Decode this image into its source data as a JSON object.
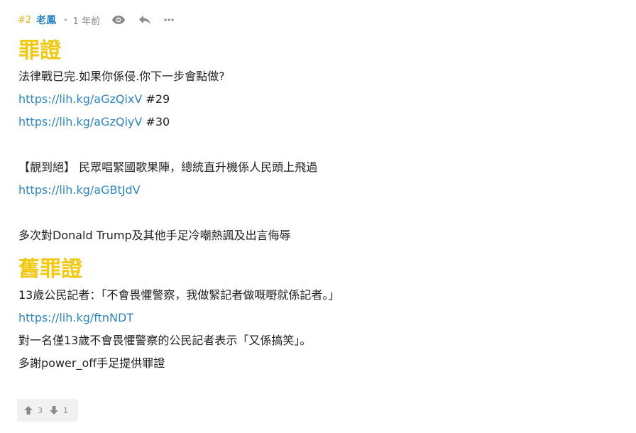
{
  "post": {
    "number": "#2",
    "author": "老鳳",
    "separator": "•",
    "time": "1 年前",
    "icons": [
      "eye-icon",
      "reply-icon",
      "more-icon"
    ]
  },
  "content": {
    "heading1": "罪證",
    "line1": "法律戰已完.如果你係侵.你下一步會點做?",
    "link1": "https://lih.kg/aGzQixV",
    "link1_suffix": " #29",
    "link2": "https://lih.kg/aGzQiyV",
    "link2_suffix": " #30",
    "line2": "【靚到絕】 民眾唱緊國歌果陣，總統直升機係人民頭上飛過",
    "link3": "https://lih.kg/aGBtJdV",
    "line3": "多次對Donald Trump及其他手足冷嘲熱諷及出言侮辱",
    "heading2": "舊罪證",
    "line4": "13歲公民記者：「不會畏懼警察，我做緊記者做嘅嘢就係記者。」",
    "link4": "https://lih.kg/ftnNDT",
    "line5": "對一名僅13歲不會畏懼警察的公民記者表示「又係搞笑」。",
    "line6": "多謝power_off手足提供罪證"
  },
  "votes": {
    "up_count": "3",
    "down_count": "1"
  },
  "colors": {
    "accent_yellow": "#f2c811",
    "link_blue": "#2e86c1",
    "muted": "#8a8a8a"
  }
}
